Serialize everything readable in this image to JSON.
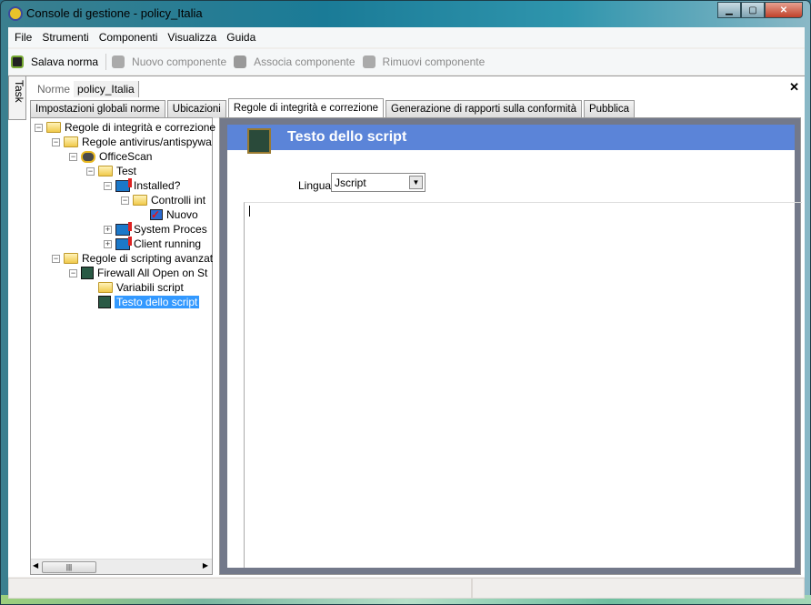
{
  "window": {
    "title": "Console di gestione  - policy_Italia"
  },
  "menu": [
    "File",
    "Strumenti",
    "Componenti",
    "Visualizza",
    "Guida"
  ],
  "toolbar": {
    "save": "Salava norma",
    "new": "Nuovo componente",
    "associate": "Associa componente",
    "remove": "Rimuovi componente"
  },
  "task_tab": "Task",
  "breadcrumb": {
    "root": "Norme",
    "current": "policy_Italia"
  },
  "tabs": [
    "Impostazioni globali norme",
    "Ubicazioni",
    "Regole di integrità e correzione",
    "Generazione di rapporti sulla conformità",
    "Pubblica"
  ],
  "tree": [
    {
      "label": "Regole di integrità e correzione",
      "level": 0,
      "icon": "folder",
      "exp": "-"
    },
    {
      "label": "Regole antivirus/antispywa",
      "level": 1,
      "icon": "folder",
      "exp": "-"
    },
    {
      "label": "OfficeScan",
      "level": 2,
      "icon": "officescan",
      "exp": "-"
    },
    {
      "label": "Test",
      "level": 3,
      "icon": "folder",
      "exp": "-"
    },
    {
      "label": "Installed?",
      "level": 4,
      "icon": "computer",
      "exp": "-"
    },
    {
      "label": "Controlli int",
      "level": 5,
      "icon": "folder",
      "exp": "-"
    },
    {
      "label": "Nuovo",
      "level": 6,
      "icon": "check",
      "exp": ""
    },
    {
      "label": "System Proces",
      "level": 4,
      "icon": "computer",
      "exp": "+"
    },
    {
      "label": "Client running",
      "level": 4,
      "icon": "computer",
      "exp": "+"
    },
    {
      "label": "Regole di scripting avanzat",
      "level": 1,
      "icon": "folder",
      "exp": "-"
    },
    {
      "label": "Firewall All Open on St",
      "level": 2,
      "icon": "script",
      "exp": "-"
    },
    {
      "label": "Variabili script",
      "level": 3,
      "icon": "folder",
      "exp": ""
    },
    {
      "label": "Testo dello script",
      "level": 3,
      "icon": "script",
      "exp": "",
      "selected": true
    }
  ],
  "panel": {
    "title": "Testo dello script",
    "language_label": "Lingua",
    "language_value": "Jscript",
    "script_text": ""
  }
}
